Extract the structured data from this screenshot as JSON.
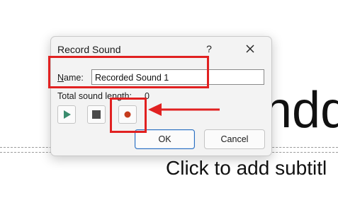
{
  "slide": {
    "title_fragment": "ndd",
    "subtitle": "Click to add subtitl"
  },
  "dialog": {
    "title": "Record Sound",
    "help_glyph": "?",
    "name_label_accel": "N",
    "name_label_rest": "ame:",
    "name_value": "Recorded Sound 1",
    "total_label": "Total sound length:",
    "total_value": "0",
    "ok_label": "OK",
    "cancel_label": "Cancel"
  },
  "icons": {
    "close": "close-icon",
    "play": "play-icon",
    "stop": "stop-icon",
    "record": "record-icon",
    "arrow": "arrow-left-icon"
  },
  "colors": {
    "annotation_red": "#e12121",
    "play_green": "#3a8c6e",
    "stop_gray": "#4a4a4a",
    "record_red": "#c43b1c",
    "ok_border": "#2a6ebf"
  }
}
